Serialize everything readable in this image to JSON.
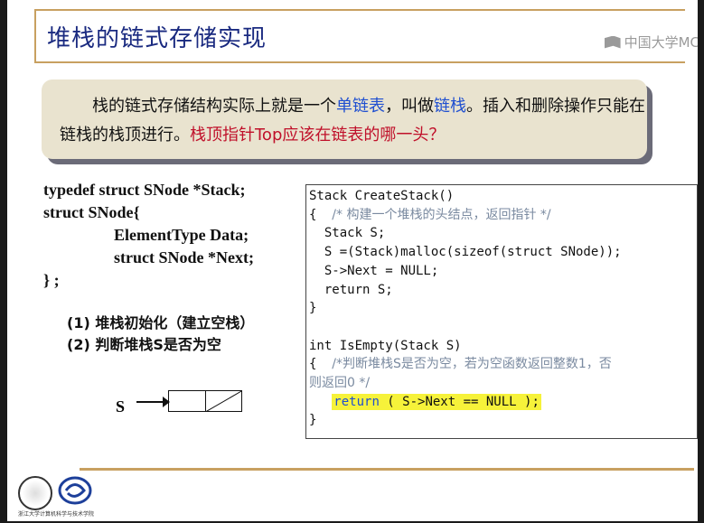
{
  "slide": {
    "title": "堆栈的链式存储实现",
    "watermark": "中国大学MC",
    "callout": {
      "text_lead": "栈的链式存储结构实际上就是一个",
      "text_link1": "单链表",
      "text_mid": "，叫做",
      "text_link2": "链栈",
      "text_tail": "。插入和删除操作只能在链栈的栈顶进行。",
      "question": "栈顶指针Top应该在链表的哪一头？"
    },
    "struct_lines": [
      "typedef struct SNode *Stack;",
      "struct SNode{",
      "ElementType  Data;",
      "struct SNode *Next;",
      "} ;"
    ],
    "ops": [
      "(1) 堆栈初始化（建立空栈）",
      "(2) 判断堆栈S是否为空"
    ],
    "diagram_label": "S",
    "code": {
      "l1": "Stack CreateStack()",
      "l2a": "{  ",
      "l2b": "/* 构建一个堆栈的头结点，返回指针 */",
      "l3": "  Stack S;",
      "l4": "  S =(Stack)malloc(sizeof(struct SNode));",
      "l5": "  S->Next = NULL;",
      "l6": "  return S;",
      "l7": "}",
      "l8": "",
      "l9": "int IsEmpty(Stack S)",
      "l10a": "{  ",
      "l10b": "/*判断堆栈S是否为空，若为空函数返回整数1，否",
      "l11": "则返回0 */",
      "l12_kw": "return",
      "l12_rest": " ( S->Next == NULL );",
      "l13": "}"
    },
    "footer_caption": "浙江大学计算机科学与技术学院"
  },
  "colors": {
    "title": "#1a2a80",
    "accent_rule": "#c8a060",
    "callout_bg": "#e9e3cf",
    "link_blue": "#1f4fd0",
    "question_red": "#c0102a",
    "highlight": "#f6f23a"
  }
}
